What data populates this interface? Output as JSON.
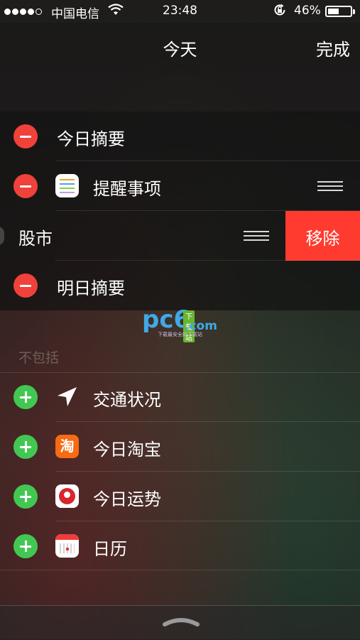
{
  "status_bar": {
    "carrier": "中国电信",
    "time": "23:48",
    "battery_percent": "46%",
    "signal_bars_filled": 4,
    "battery_level": 0.46
  },
  "nav": {
    "title": "今天",
    "done_label": "完成"
  },
  "included": [
    {
      "label": "今日摘要"
    },
    {
      "label": "提醒事项",
      "icon": "reminders-app-icon"
    },
    {
      "label": "股市",
      "remove_label": "移除",
      "swiped": true
    },
    {
      "label": "明日摘要"
    }
  ],
  "excluded_header": "不包括",
  "excluded": [
    {
      "label": "交通状况",
      "icon": "location-arrow-icon"
    },
    {
      "label": "今日淘宝",
      "icon": "taobao-app-icon",
      "glyph": "淘"
    },
    {
      "label": "今日运势",
      "icon": "fortune-app-icon"
    },
    {
      "label": "日历",
      "icon": "calendar-app-icon"
    }
  ],
  "watermark": {
    "brand": "pc6",
    "badge": "下载站",
    "domain": ".com",
    "slogan": "下载最安全的下载站"
  },
  "colors": {
    "remove_red": "#f0413a",
    "add_green": "#42c852",
    "swipe_delete": "#ff3b30"
  }
}
